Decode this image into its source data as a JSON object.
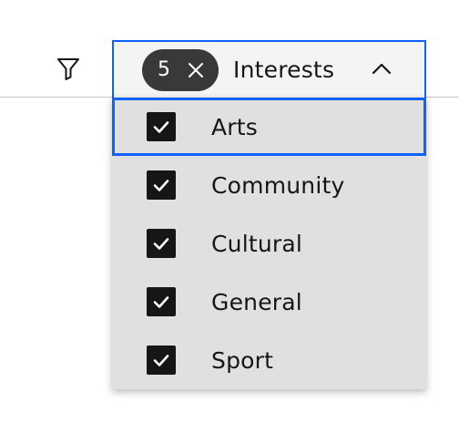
{
  "filter": {
    "icon": "filter-icon"
  },
  "multiselect": {
    "selected_count": "5",
    "clear_icon": "close-icon",
    "label": "Interests",
    "chevron_icon": "chevron-up-icon",
    "expanded": true
  },
  "menu": {
    "items": [
      {
        "label": "Arts",
        "checked": true,
        "focused": true
      },
      {
        "label": "Community",
        "checked": true,
        "focused": false
      },
      {
        "label": "Cultural",
        "checked": true,
        "focused": false
      },
      {
        "label": "General",
        "checked": true,
        "focused": false
      },
      {
        "label": "Sport",
        "checked": true,
        "focused": false
      }
    ]
  },
  "colors": {
    "focus": "#0f62fe",
    "tag_background": "#393939",
    "menu_background": "#e0e0e0",
    "field_background": "#f4f4f4",
    "checkbox_fill": "#161616",
    "text": "#161616"
  }
}
